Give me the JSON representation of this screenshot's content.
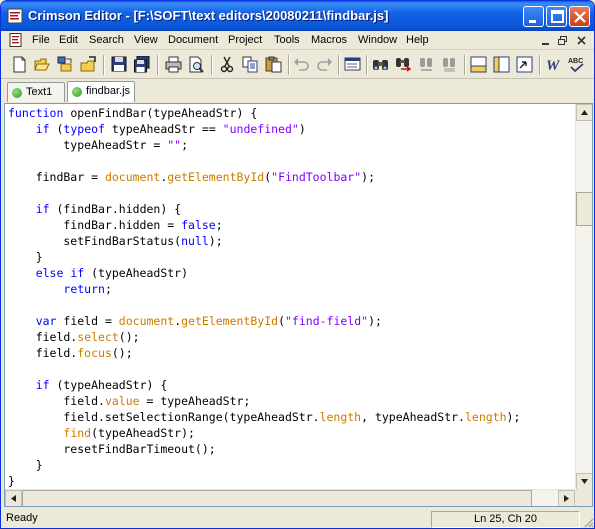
{
  "window": {
    "title": "Crimson Editor - [F:\\SOFT\\text editors\\20080211\\findbar.js]"
  },
  "menu": {
    "items": [
      "File",
      "Edit",
      "Search",
      "View",
      "Document",
      "Project",
      "Tools",
      "Macros",
      "Window",
      "Help"
    ]
  },
  "toolbar": {
    "icons": [
      "new-file-icon",
      "open-folder-icon",
      "open-project-icon",
      "open-remote-icon",
      "save-icon",
      "save-all-icon",
      "print-icon",
      "print-preview-icon",
      "cut-icon",
      "copy-icon",
      "paste-icon",
      "undo-icon",
      "redo-icon",
      "toggle-view-icon",
      "find-icon",
      "find-next-icon",
      "replace-icon",
      "replace-all-icon",
      "toggle-output-icon",
      "toggle-sidebar-icon",
      "toggle-tab-icon",
      "word-wrap-icon",
      "spell-check-icon"
    ]
  },
  "tabs": [
    {
      "label": "Text1",
      "active": false
    },
    {
      "label": "findbar.js",
      "active": true
    }
  ],
  "editor": {
    "lines": [
      [
        [
          "kw",
          "function"
        ],
        [
          "pl",
          " openFindBar(typeAheadStr) {"
        ]
      ],
      [
        [
          "pl",
          "    "
        ],
        [
          "kw",
          "if"
        ],
        [
          "pl",
          " ("
        ],
        [
          "kw",
          "typeof"
        ],
        [
          "pl",
          " typeAheadStr == "
        ],
        [
          "str",
          "\"undefined\""
        ],
        [
          "pl",
          ")"
        ]
      ],
      [
        [
          "pl",
          "        typeAheadStr = "
        ],
        [
          "str",
          "\"\""
        ],
        [
          "pl",
          ";"
        ]
      ],
      [
        [
          "pl",
          ""
        ]
      ],
      [
        [
          "pl",
          "    findBar = "
        ],
        [
          "fn",
          "document"
        ],
        [
          "pl",
          "."
        ],
        [
          "fn",
          "getElementById"
        ],
        [
          "pl",
          "("
        ],
        [
          "str",
          "\"FindToolbar\""
        ],
        [
          "pl",
          ");"
        ]
      ],
      [
        [
          "pl",
          ""
        ]
      ],
      [
        [
          "pl",
          "    "
        ],
        [
          "kw",
          "if"
        ],
        [
          "pl",
          " (findBar.hidden) {"
        ]
      ],
      [
        [
          "pl",
          "        findBar.hidden = "
        ],
        [
          "kw",
          "false"
        ],
        [
          "pl",
          ";"
        ]
      ],
      [
        [
          "pl",
          "        setFindBarStatus("
        ],
        [
          "kw",
          "null"
        ],
        [
          "pl",
          ");"
        ]
      ],
      [
        [
          "pl",
          "    }"
        ]
      ],
      [
        [
          "pl",
          "    "
        ],
        [
          "kw",
          "else if"
        ],
        [
          "pl",
          " (typeAheadStr)"
        ]
      ],
      [
        [
          "pl",
          "        "
        ],
        [
          "kw",
          "return"
        ],
        [
          "pl",
          ";"
        ]
      ],
      [
        [
          "pl",
          ""
        ]
      ],
      [
        [
          "pl",
          "    "
        ],
        [
          "kw",
          "var"
        ],
        [
          "pl",
          " field = "
        ],
        [
          "fn",
          "document"
        ],
        [
          "pl",
          "."
        ],
        [
          "fn",
          "getElementById"
        ],
        [
          "pl",
          "("
        ],
        [
          "str",
          "\"find-field\""
        ],
        [
          "pl",
          ");"
        ]
      ],
      [
        [
          "pl",
          "    field."
        ],
        [
          "fn",
          "select"
        ],
        [
          "pl",
          "();"
        ]
      ],
      [
        [
          "pl",
          "    field."
        ],
        [
          "fn",
          "focus"
        ],
        [
          "pl",
          "();"
        ]
      ],
      [
        [
          "pl",
          ""
        ]
      ],
      [
        [
          "pl",
          "    "
        ],
        [
          "kw",
          "if"
        ],
        [
          "pl",
          " (typeAheadStr) {"
        ]
      ],
      [
        [
          "pl",
          "        field."
        ],
        [
          "fn",
          "value"
        ],
        [
          "pl",
          " = typeAheadStr;"
        ]
      ],
      [
        [
          "pl",
          "        field.setSelectionRange(typeAheadStr."
        ],
        [
          "fn",
          "length"
        ],
        [
          "pl",
          ", typeAheadStr."
        ],
        [
          "fn",
          "length"
        ],
        [
          "pl",
          ");"
        ]
      ],
      [
        [
          "pl",
          "        "
        ],
        [
          "fn",
          "find"
        ],
        [
          "pl",
          "(typeAheadStr);"
        ]
      ],
      [
        [
          "pl",
          "        resetFindBarTimeout();"
        ]
      ],
      [
        [
          "pl",
          "    }"
        ]
      ],
      [
        [
          "pl",
          "}"
        ]
      ]
    ]
  },
  "status": {
    "text": "Ready",
    "position": "Ln 25, Ch 20"
  },
  "colors": {
    "keyword": "#0000ff",
    "string": "#8000ff",
    "builtin": "#cc7a00",
    "titlebar": "#0a55d8"
  }
}
